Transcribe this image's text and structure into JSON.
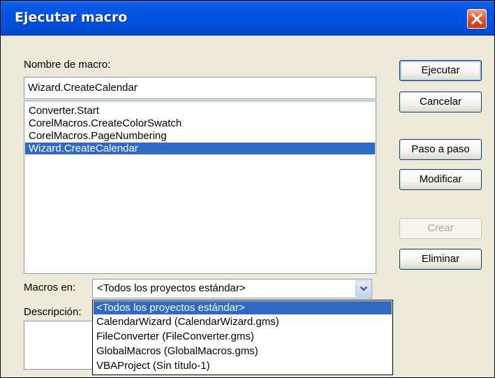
{
  "window": {
    "title": "Ejecutar macro"
  },
  "name_field": {
    "label": "Nombre de macro:",
    "value": "Wizard.CreateCalendar"
  },
  "macro_list": {
    "items": [
      "Converter.Start",
      "CorelMacros.CreateColorSwatch",
      "CorelMacros.PageNumbering",
      "Wizard.CreateCalendar"
    ],
    "selected": "Wizard.CreateCalendar"
  },
  "buttons": {
    "run": "Ejecutar",
    "cancel": "Cancelar",
    "step": "Paso a paso",
    "edit": "Modificar",
    "create": "Crear",
    "delete": "Eliminar"
  },
  "macros_in": {
    "label": "Macros en:",
    "selected": "<Todos los proyectos estándar>",
    "options": [
      "<Todos los proyectos estándar>",
      "CalendarWizard (CalendarWizard.gms)",
      "FileConverter (FileConverter.gms)",
      "GlobalMacros (GlobalMacros.gms)",
      "VBAProject (Sin título-1)"
    ]
  },
  "description": {
    "label": "Descripción:"
  },
  "icons": {
    "close": "close-icon",
    "dropdown": "chevron-down-icon"
  },
  "colors": {
    "titlebar": "#0054e3",
    "selection": "#316ac5",
    "close_button": "#e2593a",
    "dialog_background": "#ece9d8"
  }
}
